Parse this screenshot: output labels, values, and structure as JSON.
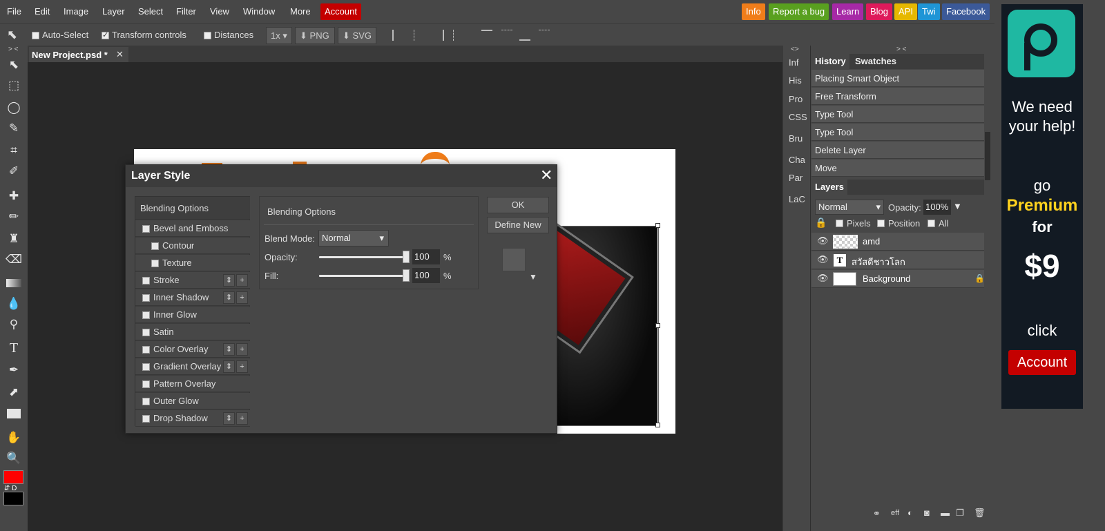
{
  "menubar": {
    "items": [
      "File",
      "Edit",
      "Image",
      "Layer",
      "Select",
      "Filter",
      "View",
      "Window",
      "More"
    ],
    "account": "Account",
    "links": [
      {
        "label": "Info",
        "color": "#f07d1a"
      },
      {
        "label": "Report a bug",
        "color": "#59a01f"
      },
      {
        "label": "Learn",
        "color": "#a629a6"
      },
      {
        "label": "Blog",
        "color": "#de1a5b"
      },
      {
        "label": "API",
        "color": "#e6b800"
      },
      {
        "label": "Twi",
        "color": "#1f95d6"
      },
      {
        "label": "Facebook",
        "color": "#3b5998"
      }
    ]
  },
  "options": {
    "auto_select": "Auto-Select",
    "transform_controls": "Transform controls",
    "distances": "Distances",
    "zoom": "1x",
    "png": "PNG",
    "svg": "SVG"
  },
  "tab": {
    "title": "New Project.psd *",
    "close": "✕",
    "collapse": "> <"
  },
  "mini_panel": {
    "collapse": "<>",
    "items": [
      "Inf",
      "His",
      "Pro",
      "CSS",
      "Bru",
      "Cha",
      "Par",
      "LaC"
    ]
  },
  "history": {
    "tabs": [
      "History",
      "Swatches"
    ],
    "collapse": "> <",
    "items": [
      "Placing Smart Object",
      "Free Transform",
      "Type Tool",
      "Type Tool",
      "Delete Layer",
      "Move"
    ]
  },
  "layers": {
    "tab": "Layers",
    "blend_mode": "Normal",
    "opacity_label": "Opacity:",
    "opacity_value": "100%",
    "lock_labels": [
      "Pixels",
      "Position",
      "All"
    ],
    "items": [
      {
        "name": "amd",
        "type": "smart"
      },
      {
        "name": "สวัสดีชาวโลก",
        "type": "text"
      },
      {
        "name": "Background",
        "type": "background"
      }
    ],
    "footer_eff": "eff"
  },
  "ad": {
    "line1": "We need",
    "line2": "your help!",
    "go": "go",
    "premium": "Premium",
    "for": "for",
    "price": "$9",
    "click": "click",
    "account": "Account"
  },
  "dialog": {
    "title": "Layer Style",
    "close": "✕",
    "effects": [
      {
        "label": "Blending Options",
        "kind": "header"
      },
      {
        "label": "Bevel and Emboss",
        "kind": "check"
      },
      {
        "label": "Contour",
        "kind": "sub"
      },
      {
        "label": "Texture",
        "kind": "sub"
      },
      {
        "label": "Stroke",
        "kind": "multi"
      },
      {
        "label": "Inner Shadow",
        "kind": "multi"
      },
      {
        "label": "Inner Glow",
        "kind": "check"
      },
      {
        "label": "Satin",
        "kind": "check"
      },
      {
        "label": "Color Overlay",
        "kind": "multi"
      },
      {
        "label": "Gradient Overlay",
        "kind": "multi"
      },
      {
        "label": "Pattern Overlay",
        "kind": "check"
      },
      {
        "label": "Outer Glow",
        "kind": "check"
      },
      {
        "label": "Drop Shadow",
        "kind": "multi"
      }
    ],
    "section_title": "Blending Options",
    "blend_mode_label": "Blend Mode:",
    "blend_mode_value": "Normal",
    "opacity_label": "Opacity:",
    "opacity_value": "100",
    "fill_label": "Fill:",
    "fill_value": "100",
    "percent": "%",
    "ok": "OK",
    "define_new": "Define New",
    "opacity_level": 1.0,
    "fill_level": 1.0
  },
  "colors": {
    "foreground": "#ff0000",
    "background": "#000000",
    "accent_orange": "#f07d1a"
  }
}
